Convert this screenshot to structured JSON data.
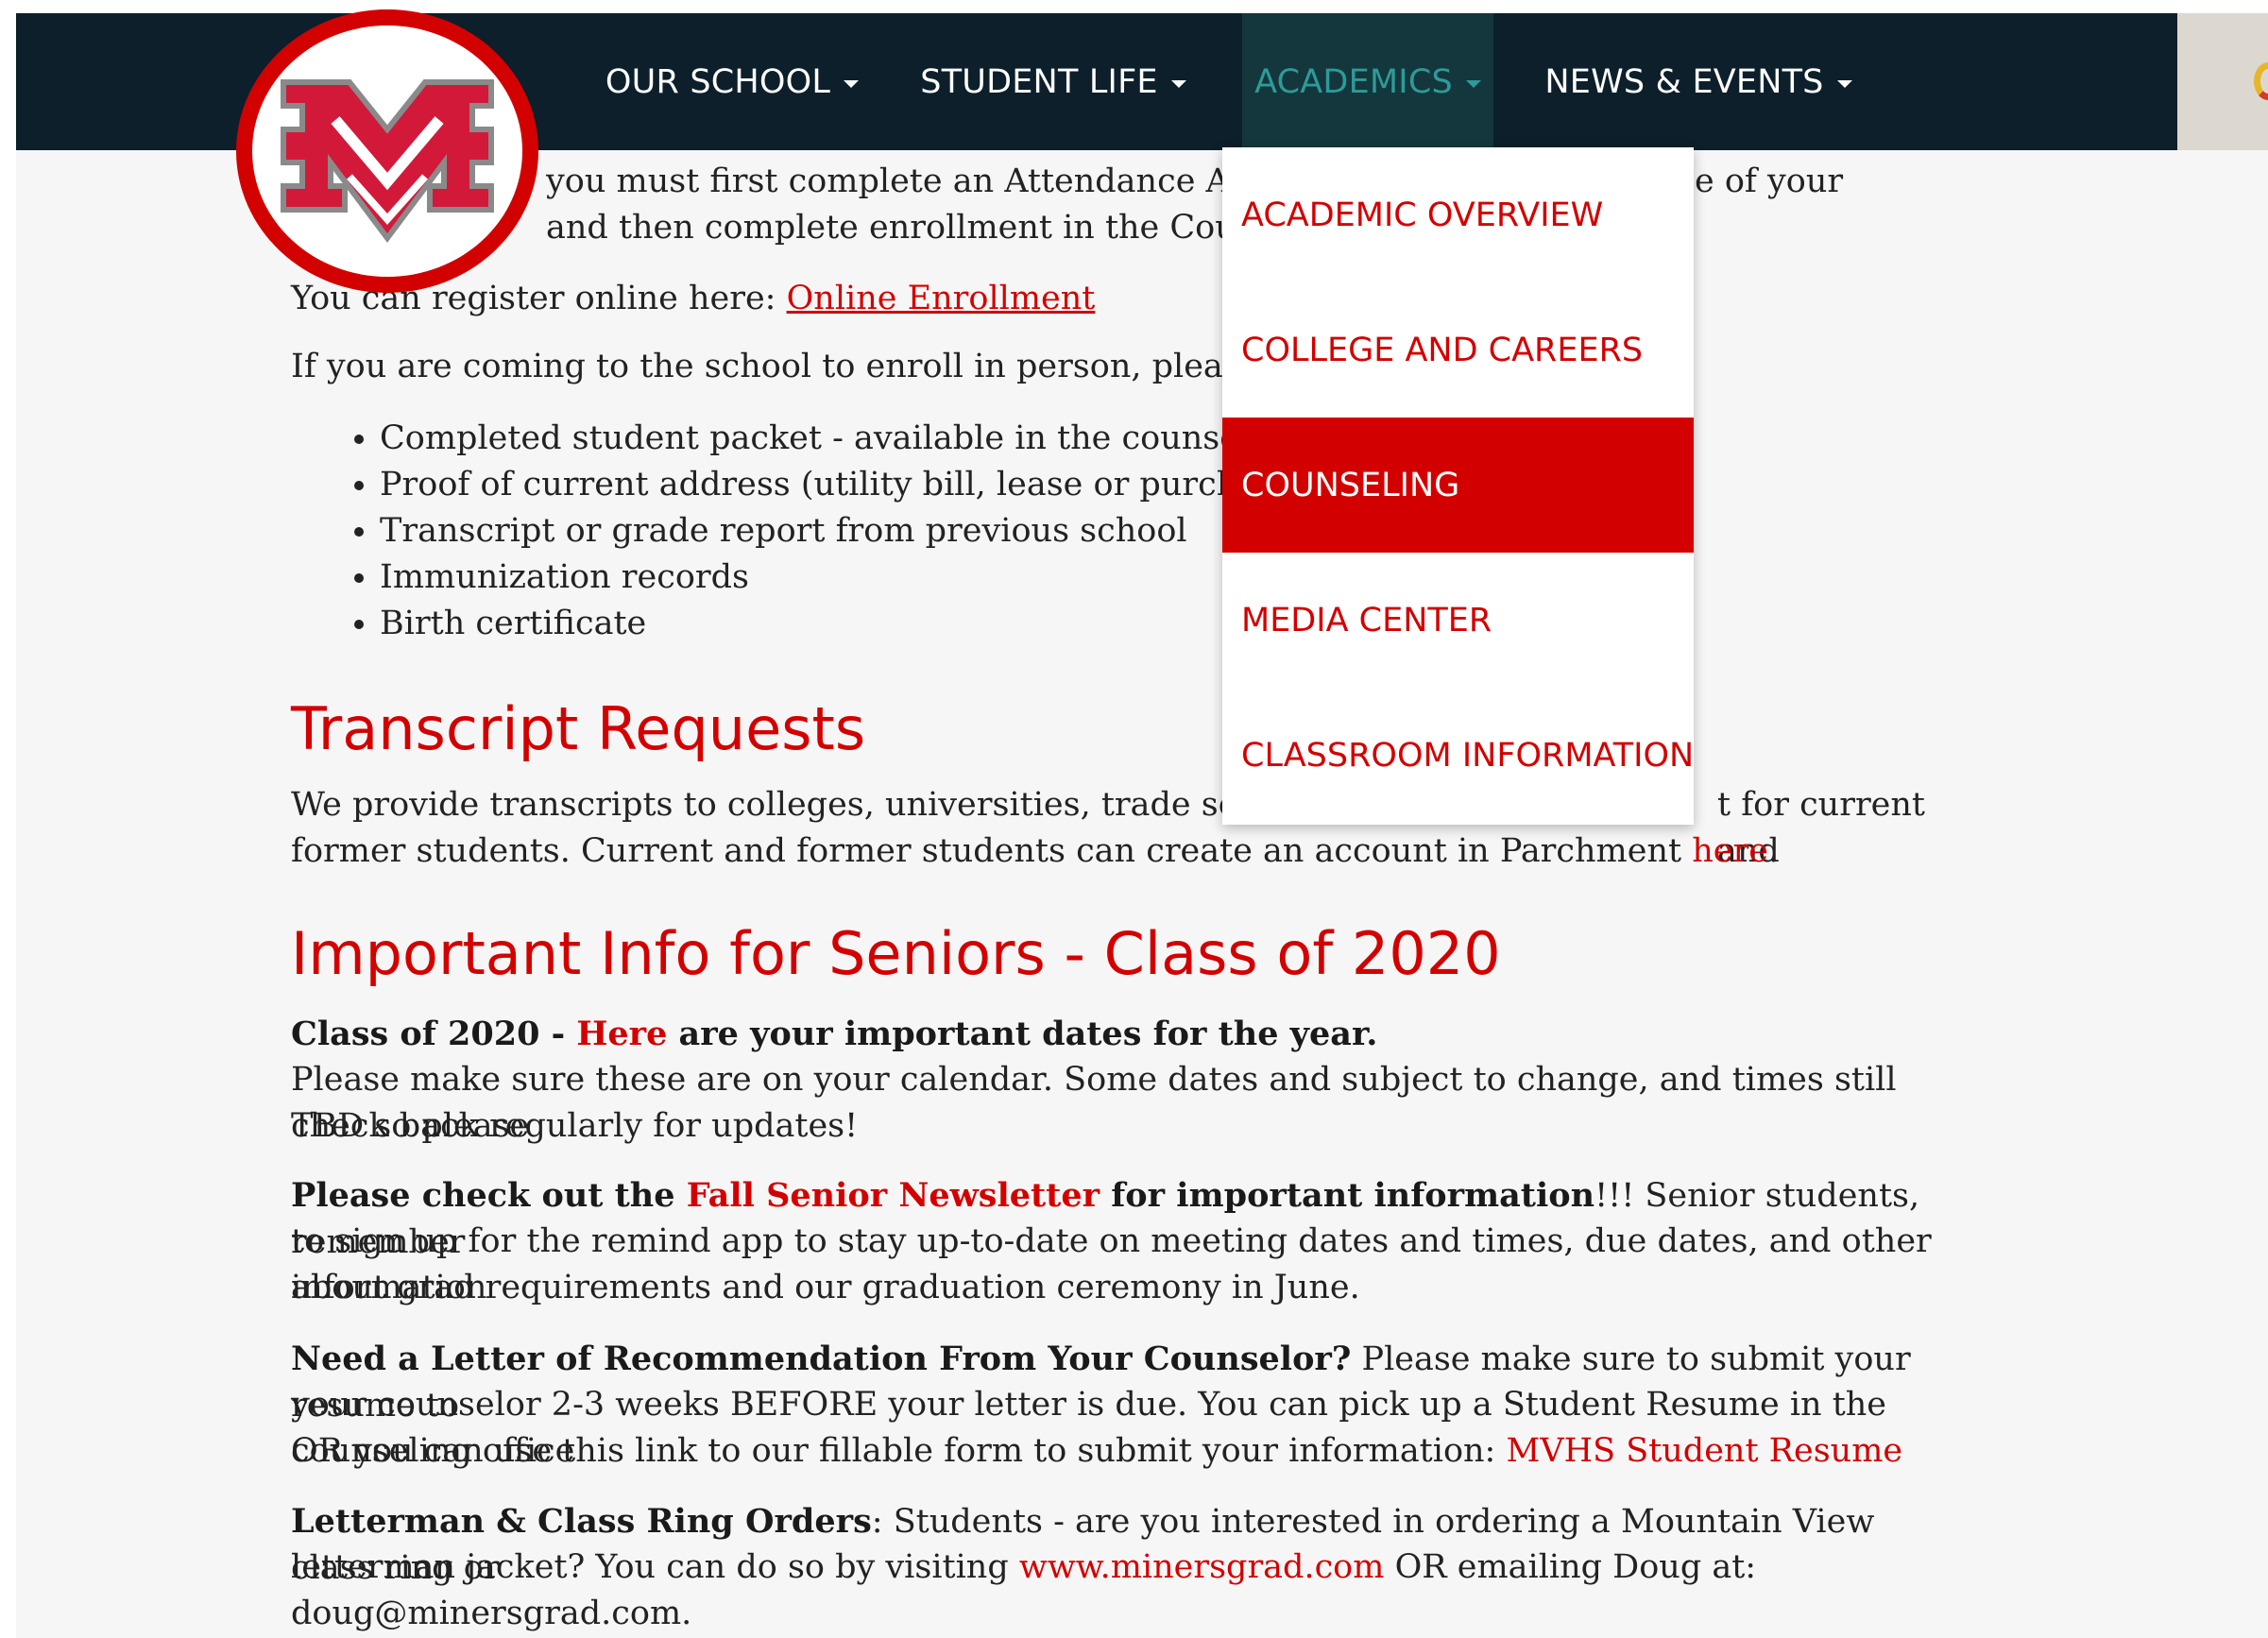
{
  "nav": {
    "items": [
      {
        "label": "OUR SCHOOL"
      },
      {
        "label": "STUDENT LIFE"
      },
      {
        "label": "ACADEMICS"
      },
      {
        "label": "NEWS & EVENTS"
      }
    ],
    "active_index": 2
  },
  "dropdown": {
    "items": [
      {
        "label": "ACADEMIC OVERVIEW"
      },
      {
        "label": "COLLEGE AND CAREERS"
      },
      {
        "label": "COUNSELING"
      },
      {
        "label": "MEDIA CENTER"
      },
      {
        "label": "CLASSROOM INFORMATION"
      }
    ],
    "active_index": 2
  },
  "enroll": {
    "line1_a": "you must first complete an Attendance Area C",
    "line1_b": "e of your",
    "line2": "and then complete enrollment in the Counselir",
    "register_prefix": "You can register online here: ",
    "register_link": "Online Enrollment",
    "in_person": "If you are coming to the school to enroll in person, please bring",
    "list": [
      "Completed student packet - available in the counseling of",
      "Proof of current address (utility bill, lease or purchase agr",
      "Transcript or grade report from previous school",
      "Immunization records",
      "Birth certificate"
    ]
  },
  "transcript": {
    "heading": "Transcript Requests",
    "line1_a": "We provide transcripts to colleges, universities, trade schools ar",
    "line1_b": "t for current and",
    "line2_prefix": "former students. Current and former students can create an account in Parchment ",
    "line2_link": "here",
    "line2_suffix": "."
  },
  "seniors": {
    "heading": "Important Info for Seniors - Class of 2020",
    "p1_bold_a": "Class of 2020 - ",
    "p1_link": "Here",
    "p1_bold_b": " are your important dates for the year.",
    "p1_line2": "Please make sure these are on your calendar. Some dates and subject to change, and times still TBD so please",
    "p1_line3": "check back regularly for updates!",
    "p2_bold_a": "Please check out the ",
    "p2_link": "Fall Senior Newsletter",
    "p2_bold_b": " for important information",
    "p2_rest": "!!! Senior students, remember",
    "p2_line2": "to sign up for the remind app to stay up-to-date on meeting dates and times, due dates, and other information",
    "p2_line3": "about grad requirements and our graduation ceremony in June.",
    "p3_bold": "Need a Letter of Recommendation From Your Counselor?",
    "p3_rest": " Please make sure to submit your resume to",
    "p3_line2": "your counselor 2-3 weeks BEFORE your letter is due. You can pick up a Student Resume in the counseling office",
    "p3_line3_prefix": "OR you can use this link to our fillable form to submit your information: ",
    "p3_link": "MVHS Student Resume",
    "p4_bold": "Letterman & Class Ring Orders",
    "p4_rest": ": Students - are you interested in ordering a Mountain View class ring or",
    "p4_line2_prefix": "letterman jacket? You can do so by visiting ",
    "p4_link": "www.minersgrad.com",
    "p4_line2_suffix": " OR emailing Doug at: doug@minersgrad.com."
  },
  "colors": {
    "nav_bg": "#0c1f2a",
    "accent_red": "#d30000",
    "active_nav_text": "#2d9b99",
    "active_nav_bg": "#13373c",
    "page_bg": "#f6f6f6"
  },
  "icons": {
    "logo": "school-m-logo",
    "caret": "caret-down-icon",
    "browser_extension": "extension-icon"
  }
}
